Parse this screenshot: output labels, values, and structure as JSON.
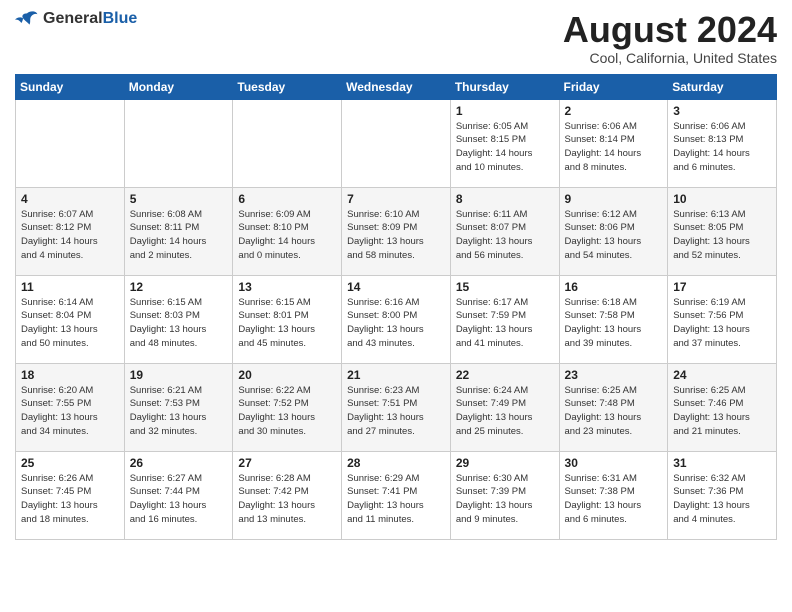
{
  "logo": {
    "general": "General",
    "blue": "Blue"
  },
  "title": {
    "month": "August 2024",
    "location": "Cool, California, United States"
  },
  "weekdays": [
    "Sunday",
    "Monday",
    "Tuesday",
    "Wednesday",
    "Thursday",
    "Friday",
    "Saturday"
  ],
  "weeks": [
    [
      {
        "day": "",
        "info": ""
      },
      {
        "day": "",
        "info": ""
      },
      {
        "day": "",
        "info": ""
      },
      {
        "day": "",
        "info": ""
      },
      {
        "day": "1",
        "info": "Sunrise: 6:05 AM\nSunset: 8:15 PM\nDaylight: 14 hours\nand 10 minutes."
      },
      {
        "day": "2",
        "info": "Sunrise: 6:06 AM\nSunset: 8:14 PM\nDaylight: 14 hours\nand 8 minutes."
      },
      {
        "day": "3",
        "info": "Sunrise: 6:06 AM\nSunset: 8:13 PM\nDaylight: 14 hours\nand 6 minutes."
      }
    ],
    [
      {
        "day": "4",
        "info": "Sunrise: 6:07 AM\nSunset: 8:12 PM\nDaylight: 14 hours\nand 4 minutes."
      },
      {
        "day": "5",
        "info": "Sunrise: 6:08 AM\nSunset: 8:11 PM\nDaylight: 14 hours\nand 2 minutes."
      },
      {
        "day": "6",
        "info": "Sunrise: 6:09 AM\nSunset: 8:10 PM\nDaylight: 14 hours\nand 0 minutes."
      },
      {
        "day": "7",
        "info": "Sunrise: 6:10 AM\nSunset: 8:09 PM\nDaylight: 13 hours\nand 58 minutes."
      },
      {
        "day": "8",
        "info": "Sunrise: 6:11 AM\nSunset: 8:07 PM\nDaylight: 13 hours\nand 56 minutes."
      },
      {
        "day": "9",
        "info": "Sunrise: 6:12 AM\nSunset: 8:06 PM\nDaylight: 13 hours\nand 54 minutes."
      },
      {
        "day": "10",
        "info": "Sunrise: 6:13 AM\nSunset: 8:05 PM\nDaylight: 13 hours\nand 52 minutes."
      }
    ],
    [
      {
        "day": "11",
        "info": "Sunrise: 6:14 AM\nSunset: 8:04 PM\nDaylight: 13 hours\nand 50 minutes."
      },
      {
        "day": "12",
        "info": "Sunrise: 6:15 AM\nSunset: 8:03 PM\nDaylight: 13 hours\nand 48 minutes."
      },
      {
        "day": "13",
        "info": "Sunrise: 6:15 AM\nSunset: 8:01 PM\nDaylight: 13 hours\nand 45 minutes."
      },
      {
        "day": "14",
        "info": "Sunrise: 6:16 AM\nSunset: 8:00 PM\nDaylight: 13 hours\nand 43 minutes."
      },
      {
        "day": "15",
        "info": "Sunrise: 6:17 AM\nSunset: 7:59 PM\nDaylight: 13 hours\nand 41 minutes."
      },
      {
        "day": "16",
        "info": "Sunrise: 6:18 AM\nSunset: 7:58 PM\nDaylight: 13 hours\nand 39 minutes."
      },
      {
        "day": "17",
        "info": "Sunrise: 6:19 AM\nSunset: 7:56 PM\nDaylight: 13 hours\nand 37 minutes."
      }
    ],
    [
      {
        "day": "18",
        "info": "Sunrise: 6:20 AM\nSunset: 7:55 PM\nDaylight: 13 hours\nand 34 minutes."
      },
      {
        "day": "19",
        "info": "Sunrise: 6:21 AM\nSunset: 7:53 PM\nDaylight: 13 hours\nand 32 minutes."
      },
      {
        "day": "20",
        "info": "Sunrise: 6:22 AM\nSunset: 7:52 PM\nDaylight: 13 hours\nand 30 minutes."
      },
      {
        "day": "21",
        "info": "Sunrise: 6:23 AM\nSunset: 7:51 PM\nDaylight: 13 hours\nand 27 minutes."
      },
      {
        "day": "22",
        "info": "Sunrise: 6:24 AM\nSunset: 7:49 PM\nDaylight: 13 hours\nand 25 minutes."
      },
      {
        "day": "23",
        "info": "Sunrise: 6:25 AM\nSunset: 7:48 PM\nDaylight: 13 hours\nand 23 minutes."
      },
      {
        "day": "24",
        "info": "Sunrise: 6:25 AM\nSunset: 7:46 PM\nDaylight: 13 hours\nand 21 minutes."
      }
    ],
    [
      {
        "day": "25",
        "info": "Sunrise: 6:26 AM\nSunset: 7:45 PM\nDaylight: 13 hours\nand 18 minutes."
      },
      {
        "day": "26",
        "info": "Sunrise: 6:27 AM\nSunset: 7:44 PM\nDaylight: 13 hours\nand 16 minutes."
      },
      {
        "day": "27",
        "info": "Sunrise: 6:28 AM\nSunset: 7:42 PM\nDaylight: 13 hours\nand 13 minutes."
      },
      {
        "day": "28",
        "info": "Sunrise: 6:29 AM\nSunset: 7:41 PM\nDaylight: 13 hours\nand 11 minutes."
      },
      {
        "day": "29",
        "info": "Sunrise: 6:30 AM\nSunset: 7:39 PM\nDaylight: 13 hours\nand 9 minutes."
      },
      {
        "day": "30",
        "info": "Sunrise: 6:31 AM\nSunset: 7:38 PM\nDaylight: 13 hours\nand 6 minutes."
      },
      {
        "day": "31",
        "info": "Sunrise: 6:32 AM\nSunset: 7:36 PM\nDaylight: 13 hours\nand 4 minutes."
      }
    ]
  ]
}
